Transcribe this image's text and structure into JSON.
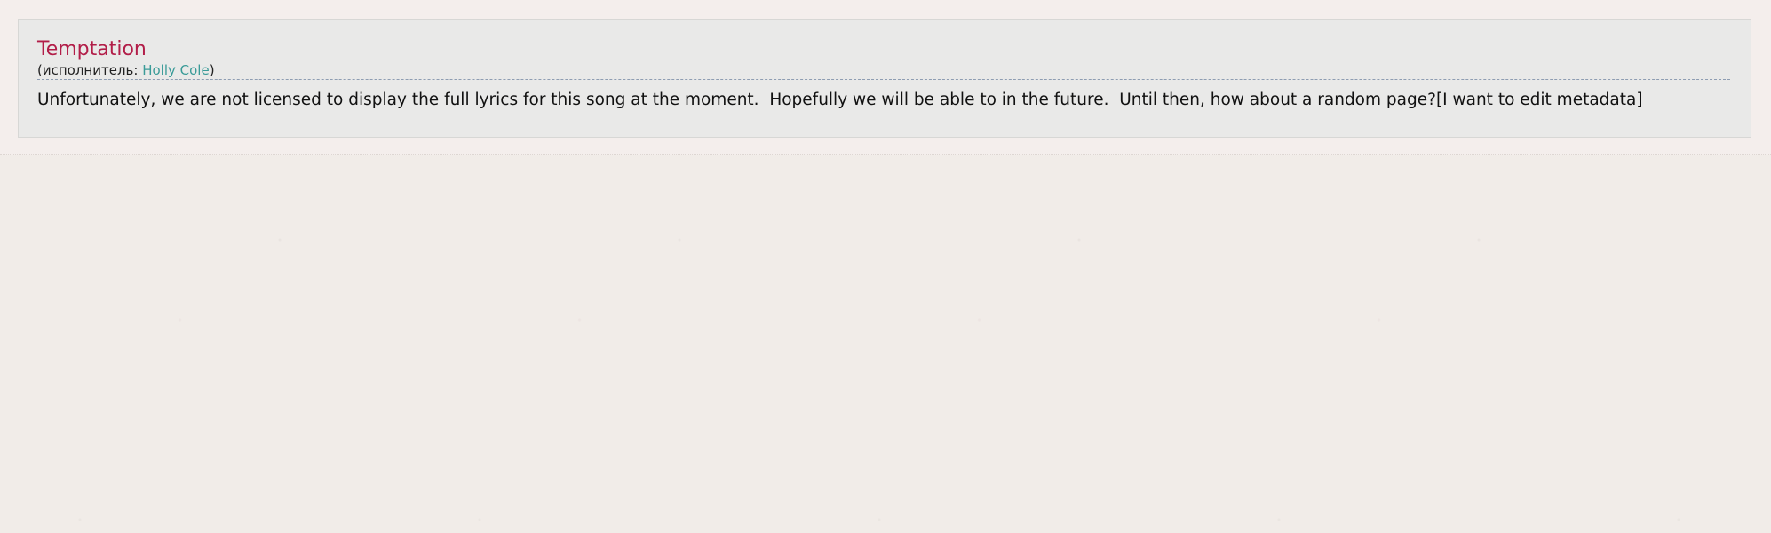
{
  "song": {
    "title": "Temptation",
    "artist_prefix": "(исполнитель: ",
    "artist_name": "Holly Cole",
    "artist_suffix": ")"
  },
  "lyrics": {
    "notice": "Unfortunately, we are not licensed to display the full lyrics for this song at the moment.  Hopefully we will be able to in the future.  Until then, how about a random page?",
    "edit_metadata_link": "[I want to edit metadata]"
  },
  "colors": {
    "page_background": "#f1ece8",
    "panel_background": "#e9e9e8",
    "title": "#b21d48",
    "artist_link": "#3a9b98",
    "divider": "#8e9db2"
  }
}
